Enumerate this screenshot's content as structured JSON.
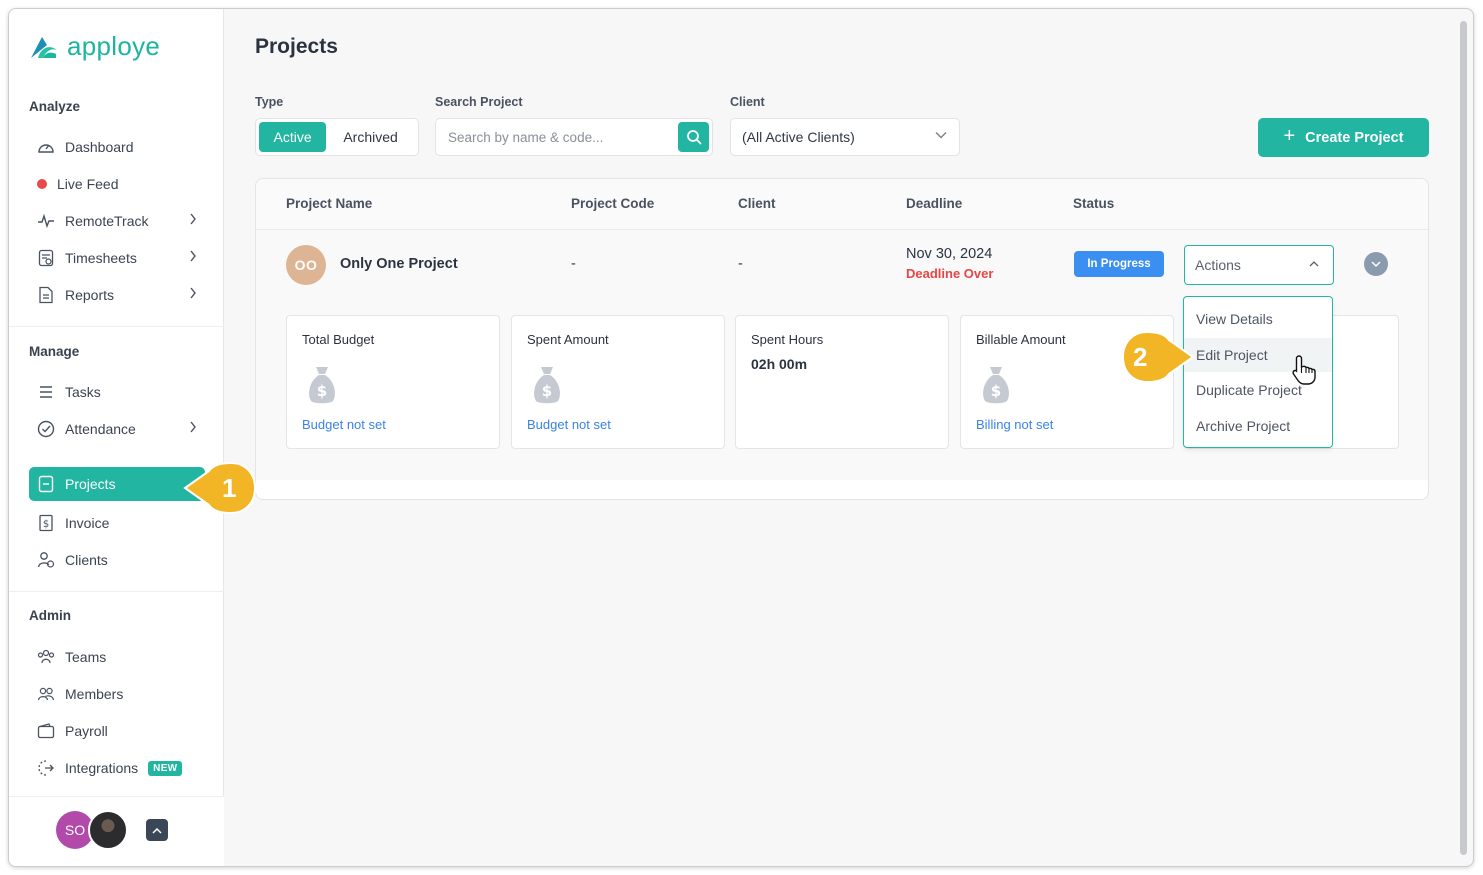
{
  "app": {
    "logo_text": "apploye"
  },
  "sidebar": {
    "sections": {
      "analyze": "Analyze",
      "manage": "Manage",
      "admin": "Admin"
    },
    "items": {
      "dashboard": "Dashboard",
      "live_feed": "Live Feed",
      "remotetrack": "RemoteTrack",
      "timesheets": "Timesheets",
      "reports": "Reports",
      "tasks": "Tasks",
      "attendance": "Attendance",
      "projects": "Projects",
      "invoice": "Invoice",
      "clients": "Clients",
      "teams": "Teams",
      "members": "Members",
      "payroll": "Payroll",
      "integrations": "Integrations"
    },
    "new_badge": "NEW",
    "user_initials": "SO",
    "live_dot_color": "#e64a4a",
    "active_color": "#22b5a2"
  },
  "main": {
    "title": "Projects",
    "filters": {
      "type_label": "Type",
      "type_active": "Active",
      "type_archived": "Archived",
      "search_label": "Search Project",
      "search_placeholder": "Search by name & code...",
      "client_label": "Client",
      "client_value": "(All Active Clients)"
    },
    "create_button": "Create Project",
    "table": {
      "headers": {
        "name": "Project Name",
        "code": "Project Code",
        "client": "Client",
        "deadline": "Deadline",
        "status": "Status"
      },
      "row": {
        "initials": "OO",
        "name": "Only One Project",
        "code": "-",
        "client": "-",
        "deadline_date": "Nov 30, 2024",
        "deadline_note": "Deadline Over",
        "status": "In Progress",
        "actions_label": "Actions"
      },
      "stats": {
        "total_budget_title": "Total Budget",
        "total_budget_link": "Budget not set",
        "spent_amount_title": "Spent Amount",
        "spent_amount_link": "Budget not set",
        "spent_hours_title": "Spent Hours",
        "spent_hours_value": "02h 00m",
        "billable_title": "Billable Amount",
        "billable_link": "Billing not set"
      }
    },
    "actions_menu": {
      "view": "View Details",
      "edit": "Edit Project",
      "duplicate": "Duplicate Project",
      "archive": "Archive Project"
    }
  },
  "annotations": {
    "step1": "1",
    "step2": "2"
  }
}
